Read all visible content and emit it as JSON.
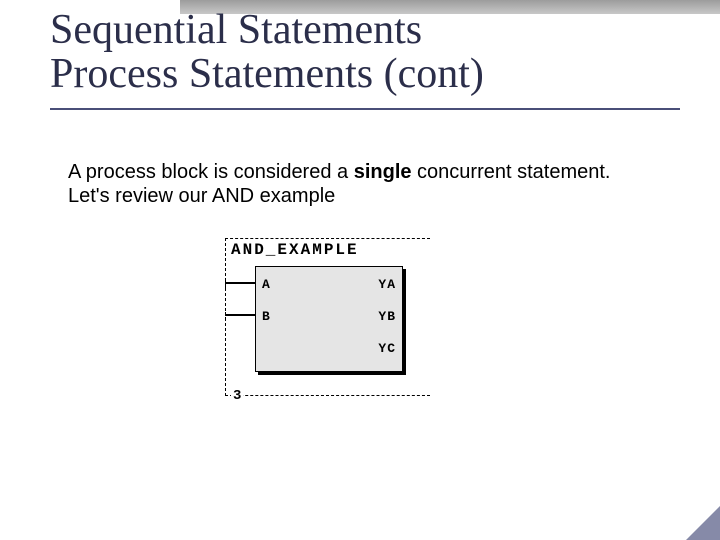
{
  "title_line1": "Sequential Statements",
  "title_line2": "Process Statements (cont)",
  "body_before": "A process block is considered a ",
  "body_single": "single",
  "body_after": "  concurrent statement.  Let's review our AND example",
  "diagram": {
    "block_name": "AND_EXAMPLE",
    "instance": "3",
    "pins": {
      "a": "A",
      "b": "B",
      "ya": "YA",
      "yb": "YB",
      "yc": "YC"
    }
  }
}
